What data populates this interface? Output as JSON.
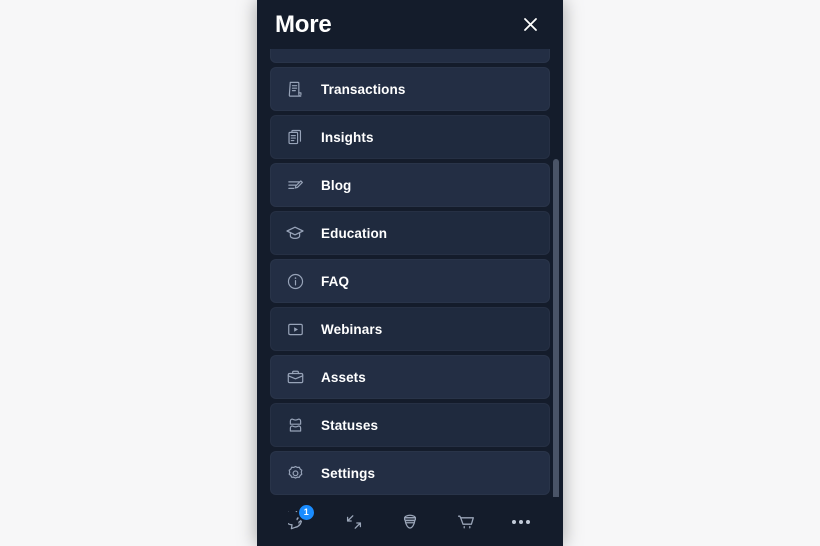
{
  "panel": {
    "title": "More",
    "close_label": "Close",
    "close_icon": "close-icon"
  },
  "menu": {
    "partial_item": {
      "label": "",
      "icon": "partial-hidden-icon"
    },
    "items": [
      {
        "label": "Transactions",
        "icon": "receipt-document-icon"
      },
      {
        "label": "Insights",
        "icon": "documents-copy-icon"
      },
      {
        "label": "Blog",
        "icon": "edit-lines-pencil-icon"
      },
      {
        "label": "Education",
        "icon": "graduation-cap-icon"
      },
      {
        "label": "FAQ",
        "icon": "info-circle-icon"
      },
      {
        "label": "Webinars",
        "icon": "play-square-icon"
      },
      {
        "label": "Assets",
        "icon": "briefcase-icon"
      },
      {
        "label": "Statuses",
        "icon": "layers-stack-icon"
      },
      {
        "label": "Settings",
        "icon": "gear-cog-icon"
      }
    ]
  },
  "scrollbar": {
    "name": "menu-scrollbar"
  },
  "bottom_bar": {
    "buttons": [
      {
        "name": "help-button",
        "icon": "help-chat-bubble-icon",
        "badge": "1"
      },
      {
        "name": "collapse-button",
        "icon": "diagonal-arrows-icon",
        "badge": ""
      },
      {
        "name": "shield-button",
        "icon": "acorn-shield-icon",
        "badge": ""
      },
      {
        "name": "cart-button",
        "icon": "shopping-cart-icon",
        "badge": ""
      },
      {
        "name": "more-button",
        "icon": "ellipsis-icon",
        "badge": ""
      }
    ]
  },
  "colors": {
    "page_background": "#f7f7f8",
    "panel_background": "#141c2b",
    "item_background": "#232e44",
    "item_background_alt": "#1f2a3e",
    "accent_badge": "#1a8cff",
    "text_primary": "#ffffff",
    "icon_muted": "#97a3b8",
    "scrollbar_thumb": "#4a5467"
  }
}
